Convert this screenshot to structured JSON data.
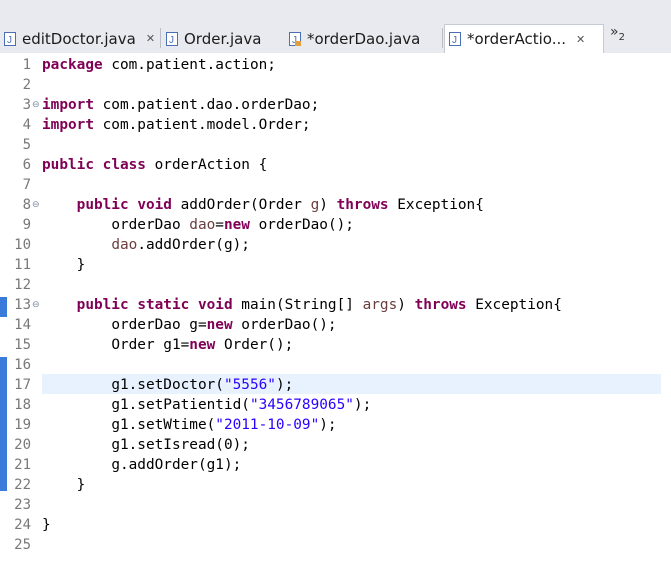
{
  "tabs": [
    {
      "label": "editDoctor.java",
      "closable": true,
      "active": false
    },
    {
      "label": "Order.java",
      "closable": false,
      "active": false
    },
    {
      "label": "*orderDao.java",
      "closable": false,
      "active": false
    },
    {
      "label": "*orderActio...",
      "closable": true,
      "active": true
    }
  ],
  "overflow": {
    "label": "»",
    "count": "2"
  },
  "line_numbers": [
    "1",
    "2",
    "3",
    "4",
    "5",
    "6",
    "7",
    "8",
    "9",
    "10",
    "11",
    "12",
    "13",
    "14",
    "15",
    "16",
    "17",
    "18",
    "19",
    "20",
    "21",
    "22",
    "23",
    "24",
    "25"
  ],
  "code": {
    "l1": {
      "kw": "package",
      "rest": " com.patient.action;"
    },
    "l3": {
      "kw": "import",
      "rest": " com.patient.dao.orderDao;"
    },
    "l4": {
      "kw": "import",
      "rest": " com.patient.model.Order;"
    },
    "l6": {
      "kw1": "public",
      "kw2": "class",
      "rest": " orderAction {"
    },
    "l8": {
      "kw1": "public",
      "kw2": "void",
      "mid": " addOrder(Order ",
      "param": "g",
      "mid2": ") ",
      "kw3": "throws",
      "rest": " Exception{"
    },
    "l9": {
      "a": "orderDao ",
      "var": "dao",
      "b": "=",
      "kw": "new",
      "c": " orderDao();"
    },
    "l10": {
      "var": "dao",
      "rest": ".addOrder(g);"
    },
    "l11": {
      "rest": "}"
    },
    "l13": {
      "kw1": "public",
      "kw2": "static",
      "kw3": "void",
      "mid": " main(String[] ",
      "param": "args",
      "mid2": ") ",
      "kw4": "throws",
      "rest": " Exception{"
    },
    "l14": {
      "a": "orderDao g=",
      "kw": "new",
      "c": " orderDao();"
    },
    "l15": {
      "a": "Order g1=",
      "kw": "new",
      "c": " Order();"
    },
    "l17": {
      "a": "g1.setDoctor(",
      "str": "\"5556\"",
      "c": ");"
    },
    "l18": {
      "a": "g1.setPatientid(",
      "str": "\"3456789065\"",
      "c": ");"
    },
    "l19": {
      "a": "g1.setWtime(",
      "str": "\"2011-10-09\"",
      "c": ");"
    },
    "l20": {
      "a": "g1.setIsread(0);"
    },
    "l21": {
      "a": "g.addOrder(g1);"
    },
    "l22": {
      "rest": "}"
    },
    "l24": {
      "rest": "}"
    }
  },
  "colors": {
    "keyword": "#7f0055",
    "string": "#2a00ff",
    "local": "#6a3e3e",
    "current_line": "#e8f2fe",
    "change_bar": "#3a7ad8"
  }
}
